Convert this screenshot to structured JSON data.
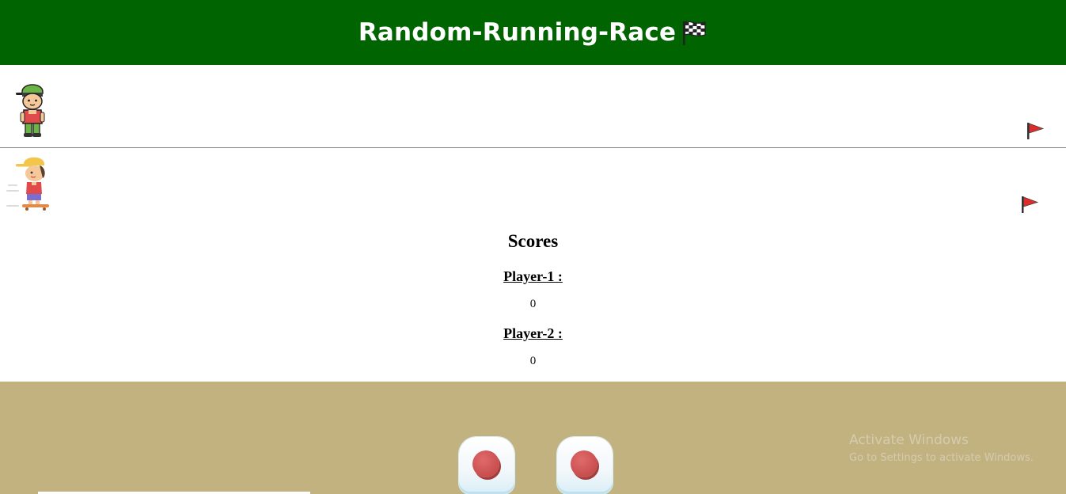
{
  "header": {
    "title": "Random-Running-Race",
    "flag_icon": "checkered-flag-icon",
    "background": "#006400"
  },
  "lanes": [
    {
      "runner_icon": "boy-green-cap-icon",
      "finish_icon": "red-flag-icon"
    },
    {
      "runner_icon": "boy-skateboard-icon",
      "finish_icon": "red-flag-icon"
    }
  ],
  "scores": {
    "title": "Scores",
    "players": [
      {
        "label": "Player-1 :",
        "score": "0"
      },
      {
        "label": "Player-2 :",
        "score": "0"
      }
    ]
  },
  "controls": {
    "background": "#c2b280",
    "dice": [
      {
        "icon": "dice-one-icon"
      },
      {
        "icon": "dice-one-icon"
      }
    ]
  },
  "watermark": {
    "line1": "Activate Windows",
    "line2": "Go to Settings to activate Windows."
  }
}
